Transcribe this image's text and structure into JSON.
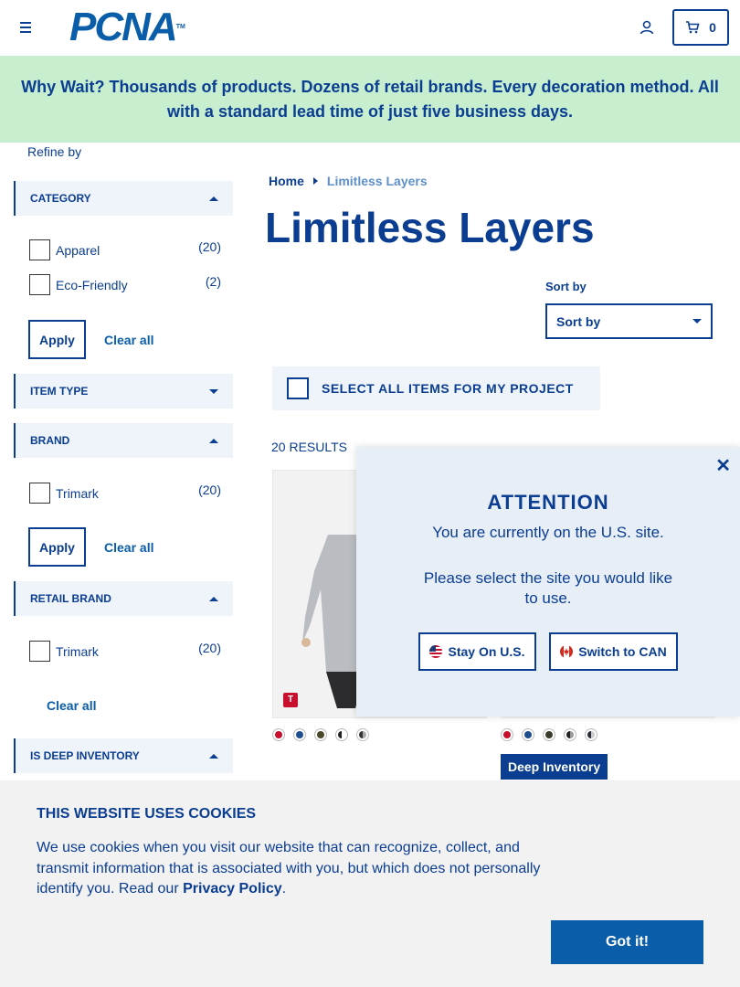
{
  "header": {
    "logo_text": "PCNA",
    "logo_tm": "TM",
    "cart_count": "0"
  },
  "banner": {
    "text": "Why Wait? Thousands of products. Dozens of retail brands. Every decoration method. All with a standard lead time of just five business days."
  },
  "sidebar": {
    "refine_label": "Refine by",
    "category": {
      "label": "CATEGORY",
      "items": [
        {
          "name": "Apparel",
          "count": "(20)"
        },
        {
          "name": "Eco-Friendly",
          "count": "(2)"
        }
      ],
      "apply": "Apply",
      "clear": "Clear all"
    },
    "item_type": {
      "label": "ITEM TYPE"
    },
    "brand": {
      "label": "BRAND",
      "items": [
        {
          "name": "Trimark",
          "count": "(20)"
        }
      ],
      "apply": "Apply",
      "clear": "Clear all"
    },
    "retail_brand": {
      "label": "RETAIL BRAND",
      "items": [
        {
          "name": "Trimark",
          "count": "(20)"
        }
      ],
      "clear": "Clear all"
    },
    "deep_inventory": {
      "label": "IS DEEP INVENTORY"
    }
  },
  "breadcrumb": {
    "home": "Home",
    "current": "Limitless Layers"
  },
  "main": {
    "title": "Limitless Layers",
    "sort_label": "Sort by",
    "sort_value": "Sort by",
    "select_all": "SELECT ALL ITEMS FOR MY PROJECT",
    "results": "20 RESULTS",
    "brand_badge": "T",
    "deep_inventory_badge": "Deep Inventory",
    "swatches_1": [
      "#c8102e",
      "#1f4e8c",
      "#4a4a2a",
      "#ffffff",
      "#555555"
    ],
    "swatches_2": [
      "#c8102e",
      "#1f4e8c",
      "#3a3a2a",
      "#666666",
      "#2a2f3a"
    ]
  },
  "modal": {
    "title": "ATTENTION",
    "line1": "You are currently on the U.S. site.",
    "line2": "Please select the site you would like to use.",
    "stay_us": "Stay On U.S.",
    "switch_can": "Switch to CAN"
  },
  "cookie": {
    "title": "THIS WEBSITE USES COOKIES",
    "body": "We use cookies when you visit our website that can recognize, collect, and transmit information that is associated with you, but which does not personally identify you. Read our",
    "policy_link": "Privacy Policy",
    "period": ".",
    "got_it": "Got it!"
  },
  "colors": {
    "brand_navy": "#0b3d91",
    "brand_blue": "#0a5da8",
    "banner_bg": "#c7eecf",
    "facet_bg": "#eef4fa",
    "modal_bg": "#e7eef6",
    "cookie_bg": "#f2f2f2"
  }
}
